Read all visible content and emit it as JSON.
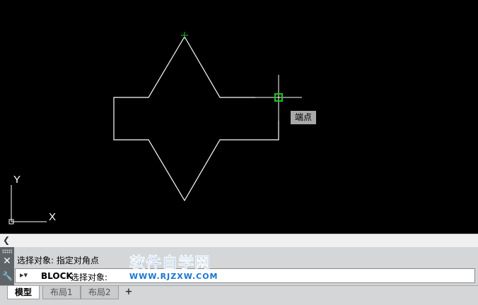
{
  "canvas": {
    "snap_tooltip": "端点",
    "ucs_y_label": "Y",
    "ucs_x_label": "X"
  },
  "command_line": {
    "history": "选择对象: 指定对角点",
    "command_name": "BLOCK",
    "prompt": "选择对象:"
  },
  "watermark": {
    "title": "软件自学网",
    "url": "WWW.RJZXW.COM"
  },
  "tabs": [
    {
      "label": "模型",
      "active": true
    },
    {
      "label": "布局1",
      "active": false
    },
    {
      "label": "布局2",
      "active": false
    }
  ],
  "add_tab": "+",
  "colors": {
    "background": "#000000",
    "geometry": "#ffffff",
    "snap_marker": "#19c819",
    "watermark": "#1a74d2"
  }
}
